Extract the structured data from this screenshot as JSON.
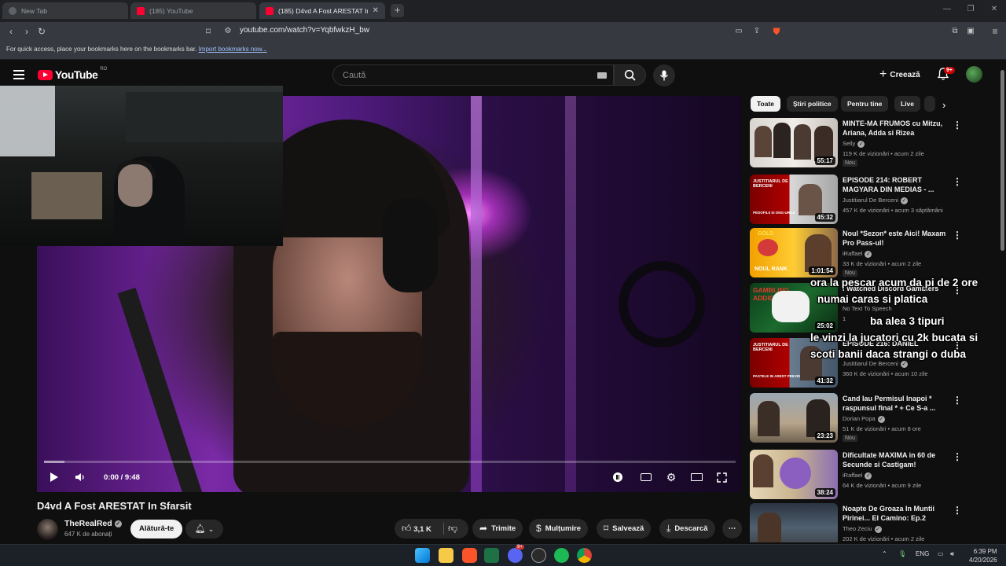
{
  "browser": {
    "tabs": [
      {
        "title": "New Tab"
      },
      {
        "title": "(185) YouTube"
      },
      {
        "title": "(185) D4vd A Fost ARESTAT In Sf..."
      }
    ],
    "url": "youtube.com/watch?v=YqbfwkzH_bw",
    "bookmarks_hint": "For quick access, place your bookmarks here on the bookmarks bar.",
    "bookmarks_link": "Import bookmarks now..."
  },
  "header": {
    "logo": "YouTube",
    "region": "RO",
    "search_placeholder": "Caută",
    "create_label": "Creează",
    "notif_count": "9+"
  },
  "player": {
    "time": "0:00 / 9:48",
    "progress": 0.0,
    "buffered": 0.03
  },
  "overlay_text": {
    "line1": "ora la pescar acum da pi de 2 ore",
    "line2": "numai caras si platica",
    "line3": "ba alea 3 tipuri",
    "line4": "le vinzi la jucatori cu 2k bucata si",
    "line5": "scoti banii daca strangi o duba"
  },
  "video": {
    "title": "D4vd A Fost ARESTAT In Sfarsit",
    "channel": "TheRealRed",
    "subscribers": "647 K de abonați",
    "join_label": "Alătură-te",
    "likes": "3,1 K",
    "share_label": "Trimite",
    "thanks_label": "Mulțumire",
    "save_label": "Salvează",
    "download_label": "Descarcă"
  },
  "chips": [
    "Toate",
    "Știri politice",
    "Pentru tine",
    "Live"
  ],
  "recommendations": [
    {
      "title": "MINTE-MA FRUMOS cu Mitzu, Ariana, Adda si Rizea",
      "channel": "Selly",
      "meta": "119 K de vizionări • acum 2 zile",
      "duration": "55:17",
      "badge": "Nou"
    },
    {
      "title": "EPISODE 214: ROBERT MAGYARA DIN MEDIAS - ...",
      "channel": "Justitiarul De Berceni",
      "meta": "457 K de vizionări • acum 3 săptămâni",
      "duration": "45:32",
      "badge": ""
    },
    {
      "title": "Noul *Sezon* este Aici! Maxam Pro Pass-ul!",
      "channel": "iRaffael",
      "meta": "33 K de vizionări • acum 2 zile",
      "duration": "1:01:54",
      "badge": "Nou"
    },
    {
      "title": "I Watched Discord Gamblers",
      "channel": "No Text To Speech",
      "meta": "1",
      "duration": "25:02",
      "badge": ""
    },
    {
      "title": "EPISODE 216: DANIEL",
      "channel": "Justitiarul De Berceni",
      "meta": "360 K de vizionări • acum 10 zile",
      "duration": "41:32",
      "badge": ""
    },
    {
      "title": "Cand Iau Permisul Inapoi * raspunsul final * + Ce S-a ...",
      "channel": "Dorian Popa",
      "meta": "51 K de vizionări • acum 8 ore",
      "duration": "23:23",
      "badge": "Nou"
    },
    {
      "title": "Dificultate MAXIMA in 60 de Secunde si Castigam!",
      "channel": "iRaffael",
      "meta": "64 K de vizionări • acum 9 zile",
      "duration": "38:24",
      "badge": ""
    },
    {
      "title": "Noapte De Groaza In Muntii Pirinei... El Camino: Ep.2",
      "channel": "Theo Zeciu",
      "meta": "202 K de vizionări • acum 2 zile",
      "duration": "",
      "badge": ""
    }
  ],
  "thumb_texts": {
    "t2": "JUSTITIARUL DE BERCENI",
    "t2b": "PEDOFILII SI ONG-URILE",
    "t3": "GOLD",
    "t3b": "NOUL RANK",
    "t4": "GAMBLING ADDICTS",
    "t5": "JUSTITIARUL DE BERCENI",
    "t5b": "PASTELE IN AREST PREVENTIV"
  },
  "taskbar": {
    "lang": "ENG",
    "time": "6:39 PM",
    "date": "4/20/2026",
    "discord_badge": "9+"
  }
}
